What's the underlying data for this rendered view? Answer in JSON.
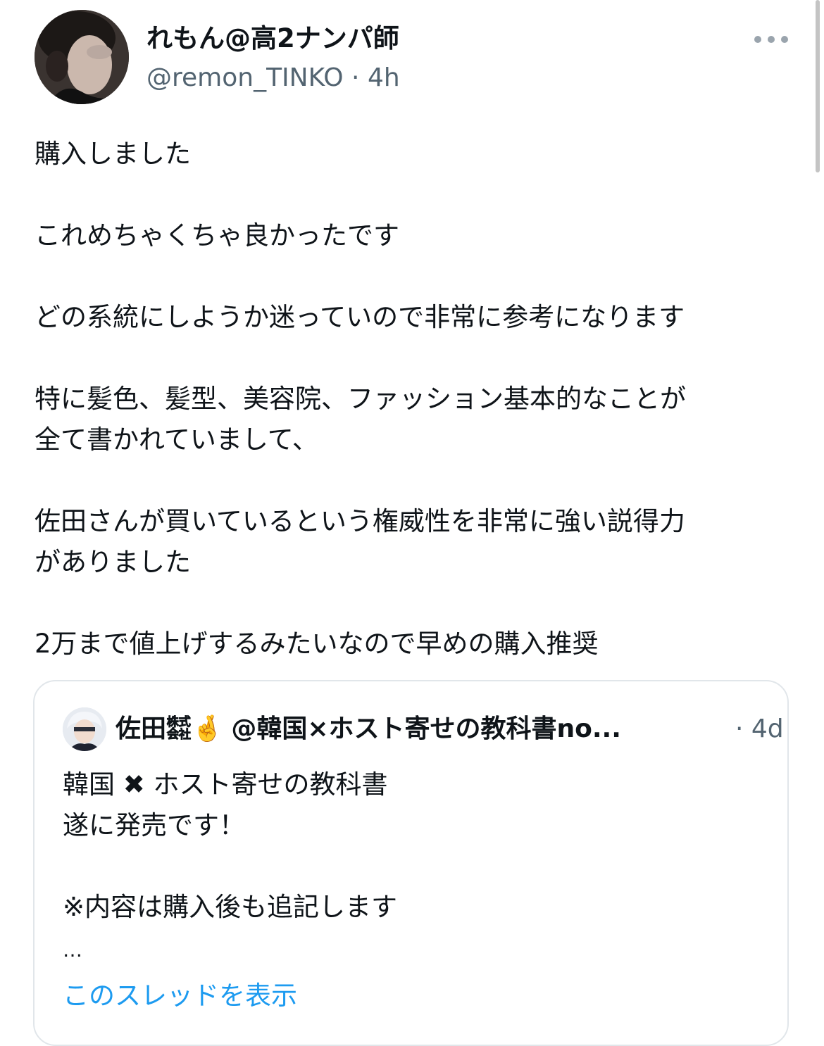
{
  "author": {
    "display_name": "れもん@高2ナンパ師",
    "handle": "@remon_TINKO",
    "separator": "·",
    "time": "4h"
  },
  "tweet": {
    "lines": [
      "購入しました",
      "これめちゃくちゃ良かったです",
      "どの系統にしようか迷っていので非常に参考になります",
      "特に髪色、髪型、美容院、ファッション基本的なことが",
      "全て書かれていまして、",
      "佐田さんが買いているという権威性を非常に強い説得力",
      "がありました",
      "2万まで値上げするみたいなので早めの購入推奨"
    ]
  },
  "quote": {
    "name": "佐田",
    "name_mark": "㍿",
    "emoji": "🤞",
    "handle": "@韓国×ホスト寄せの教科書no...",
    "time": "· 4d",
    "line1_prefix": "韓国",
    "line1_mark": "✖",
    "line1_suffix": "ホスト寄せの教科書",
    "line2": "遂に発売です！",
    "line3": "※内容は購入後も追記します",
    "ellipsis": "…",
    "show_thread": "このスレッドを表示"
  },
  "icons": {
    "more": "more-horizontal-icon"
  },
  "colors": {
    "link": "#1d9bf0",
    "secondary_text": "#536471",
    "border": "#e1e6ea"
  }
}
